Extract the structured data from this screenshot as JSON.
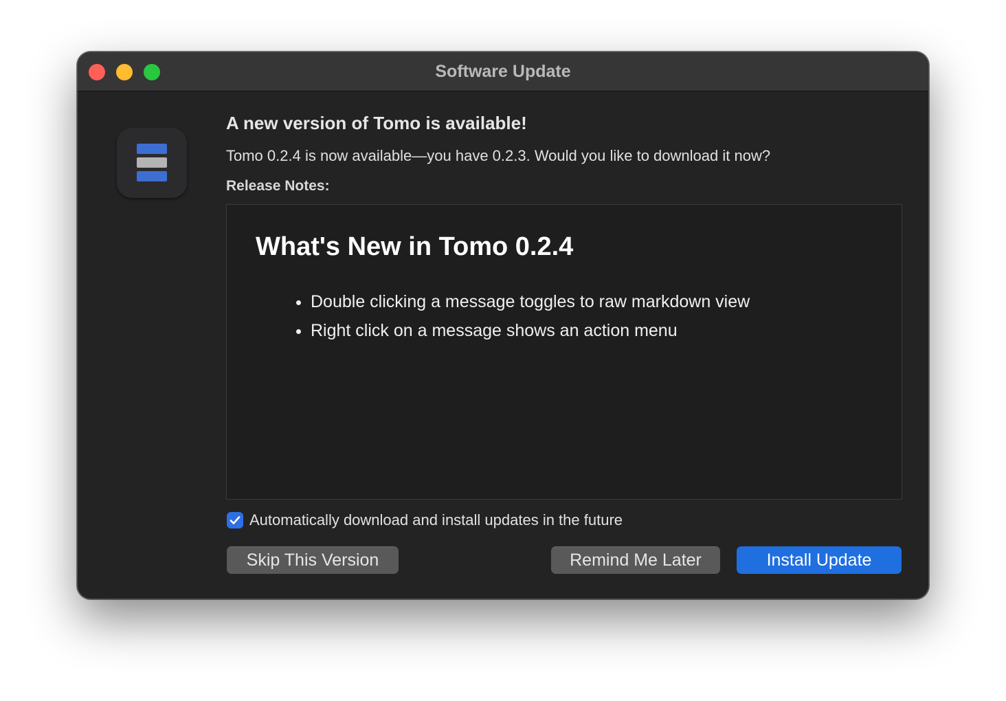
{
  "window": {
    "title": "Software Update"
  },
  "app_icon": {
    "name": "stack-icon"
  },
  "content": {
    "heading": "A new version of Tomo is available!",
    "subtext": "Tomo 0.2.4 is now available—you have 0.2.3. Would you like to download it now?",
    "release_notes_label": "Release Notes:"
  },
  "release_notes": {
    "title": "What's New in Tomo 0.2.4",
    "items": [
      "Double clicking a message toggles to raw markdown view",
      "Right click on a message shows an action menu"
    ]
  },
  "auto_update": {
    "checked": true,
    "label": "Automatically download and install updates in the future"
  },
  "buttons": {
    "skip": "Skip This Version",
    "remind": "Remind Me Later",
    "install": "Install Update"
  },
  "colors": {
    "accent": "#1f6fe0",
    "close": "#fe5f57",
    "minimize": "#febc2e",
    "zoom": "#28c840"
  }
}
